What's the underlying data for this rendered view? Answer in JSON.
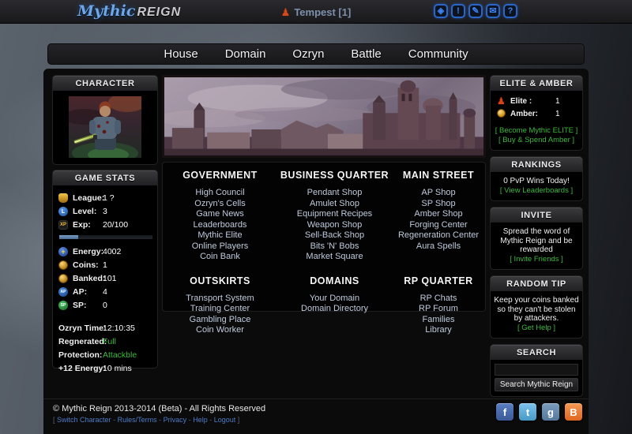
{
  "colors": {
    "accent_blue": "#3b82f0",
    "city_link": "#bfcbdd",
    "green_link": "#3cb83c",
    "footer_link": "#4d7cc9",
    "gold": "#e0a62e",
    "exp_fill": "#5b7fa6"
  },
  "topbar": {
    "logo_mythic": "Mythic",
    "logo_reign": "REIGN",
    "player_name": "Tempest [1]",
    "icons": [
      {
        "name": "alert-gem-icon",
        "glyph": "◈"
      },
      {
        "name": "notifications-icon",
        "glyph": "!"
      },
      {
        "name": "compose-icon",
        "glyph": "✎"
      },
      {
        "name": "mail-icon",
        "glyph": "✉"
      },
      {
        "name": "help-icon",
        "glyph": "?"
      }
    ]
  },
  "nav": {
    "items": [
      "House",
      "Domain",
      "Ozryn",
      "Battle",
      "Community"
    ]
  },
  "left": {
    "character": {
      "title": "CHARACTER"
    },
    "stats": {
      "title": "GAME STATS",
      "rows_top": [
        {
          "icon": "league-icon",
          "label": "League:",
          "value": "1 ?"
        },
        {
          "icon": "level-icon",
          "label": "Level:",
          "value": "3",
          "icon_glyph": "L"
        },
        {
          "icon": "exp-icon",
          "label": "Exp:",
          "value": "20/100",
          "icon_glyph": "XP"
        }
      ],
      "exp_percent": 20,
      "rows_mid": [
        {
          "icon": "energy-icon",
          "label": "Energy:",
          "value": "4002",
          "icon_glyph": "+"
        },
        {
          "icon": "coins-icon",
          "label": "Coins:",
          "value": "1"
        },
        {
          "icon": "banked-icon",
          "label": "Banked:",
          "value": "101"
        },
        {
          "icon": "ap-icon",
          "label": "AP:",
          "value": "4",
          "icon_glyph": "AP"
        },
        {
          "icon": "sp-icon",
          "label": "SP:",
          "value": "0",
          "icon_glyph": "SP"
        }
      ],
      "rows_info": [
        {
          "label": "Ozryn Time:",
          "value": "12:10:35"
        },
        {
          "label": "Regnerated:",
          "value": "Full"
        },
        {
          "label": "Protection:",
          "value": "Attackble"
        },
        {
          "label": "+12 Energy:",
          "value": "10 mins"
        }
      ]
    }
  },
  "city": {
    "sections": [
      {
        "title": "GOVERNMENT",
        "links": [
          "High Council",
          "Ozryn's Cells",
          "Game News",
          "Leaderboards",
          "Mythic Elite",
          "Online Players",
          "Coin Bank"
        ]
      },
      {
        "title": "BUSINESS QUARTER",
        "links": [
          "Pendant Shop",
          "Amulet Shop",
          "Equipment Recipes",
          "Weapon Shop",
          "Sell-Back Shop",
          "Bits 'N' Bobs",
          "Market Square"
        ]
      },
      {
        "title": "MAIN STREET",
        "links": [
          "AP Shop",
          "SP Shop",
          "Amber Shop",
          "Forging Center",
          "Regeneration Center",
          "Aura Spells"
        ]
      },
      {
        "title": "OUTSKIRTS",
        "links": [
          "Transport System",
          "Training Center",
          "Gambling Place",
          "Coin Worker"
        ]
      },
      {
        "title": "DOMAINS",
        "links": [
          "Your Domain",
          "Domain Directory"
        ]
      },
      {
        "title": "RP QUARTER",
        "links": [
          "RP Chats",
          "RP Forum",
          "Families",
          "Library"
        ]
      }
    ]
  },
  "right": {
    "elite_amber": {
      "title": "ELITE & AMBER",
      "rows": [
        {
          "icon": "elite-icon",
          "label": "Elite :",
          "value": "1"
        },
        {
          "icon": "amber-icon",
          "label": "Amber:",
          "value": "1"
        }
      ],
      "links": [
        "[ Become Mythic ELITE ]",
        "[ Buy & Spend Amber ]"
      ]
    },
    "rankings": {
      "title": "RANKINGS",
      "text": "0 PvP Wins Today!",
      "link": "[ View Leaderboards ]"
    },
    "invite": {
      "title": "INVITE",
      "text": "Spread the word of Mythic Reign and be rewarded",
      "link": "[ Invite Friends ]"
    },
    "tip": {
      "title": "RANDOM TIP",
      "text": "Keep your coins banked so they can't be stolen by attackers.",
      "link": "[ Get Help ]"
    },
    "search": {
      "title": "SEARCH",
      "input_value": "",
      "button_label": "Search Mythic Reign"
    }
  },
  "footer": {
    "copyright": "© Mythic Reign 2013-2014 (Beta) - All Rights Reserved",
    "bracket_open": "[",
    "bracket_close": "]",
    "separator": "-",
    "links": [
      "Switch Character",
      "Rules/Terms",
      "Privacy",
      "Help",
      "Logout"
    ],
    "social": [
      {
        "name": "facebook-icon",
        "glyph": "f",
        "color": "#3b5998"
      },
      {
        "name": "twitter-icon",
        "glyph": "t",
        "color": "#55acee"
      },
      {
        "name": "google-icon",
        "glyph": "g",
        "color": "#54789c"
      },
      {
        "name": "blogger-icon",
        "glyph": "B",
        "color": "#e0661e"
      }
    ]
  }
}
